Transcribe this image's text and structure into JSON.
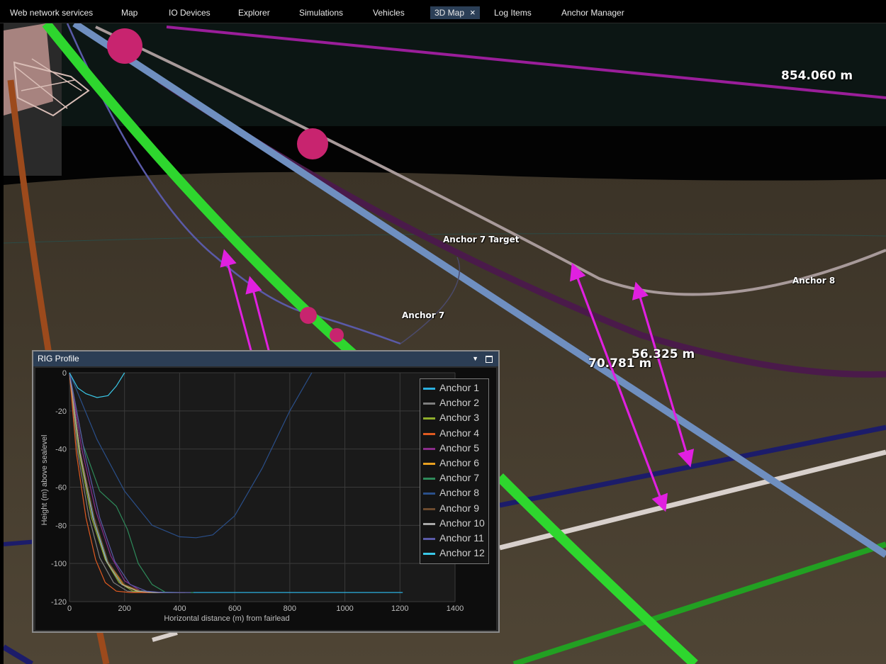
{
  "tabs": [
    {
      "label": "Web network services",
      "active": false
    },
    {
      "label": "Map",
      "active": false
    },
    {
      "label": "IO Devices",
      "active": false
    },
    {
      "label": "Explorer",
      "active": false
    },
    {
      "label": "Simulations",
      "active": false
    },
    {
      "label": "Vehicles",
      "active": false
    },
    {
      "label": "3D Map",
      "active": true,
      "closable": true,
      "close_icon": "×"
    },
    {
      "label": "Log Items",
      "active": false
    },
    {
      "label": "Anchor Manager",
      "active": false
    }
  ],
  "scene": {
    "labels": {
      "distance_top": "854.060 m",
      "anchor7_target": "Anchor 7 Target",
      "anchor8": "Anchor 8",
      "anchor7": "Anchor 7",
      "distance_a": "70.781 m",
      "distance_b": "56.325 m"
    },
    "colors": {
      "seabed": "#4a4032",
      "water": "#0c1614",
      "green_line": "#2ed62e",
      "blue_line": "#6f8fc0",
      "purple_line": "#4a1a4a",
      "magenta_arrow": "#e020e0",
      "buoy": "#c8246f"
    }
  },
  "rig_panel": {
    "title": "RIG Profile",
    "dropdown_icon": "▼",
    "maximize_icon": "maximize-icon"
  },
  "chart_data": {
    "type": "line",
    "title": "",
    "xlabel": "Horizontal distance (m) from fairlead",
    "ylabel": "Height (m) above sealevel",
    "xlim": [
      0,
      1400
    ],
    "ylim": [
      -120,
      0
    ],
    "x_ticks": [
      0,
      200,
      400,
      600,
      800,
      1000,
      1200,
      1400
    ],
    "y_ticks": [
      0,
      -20,
      -40,
      -60,
      -80,
      -100,
      -120
    ],
    "grid": true,
    "legend": "top-right",
    "series": [
      {
        "name": "Anchor 1",
        "color": "#2bb0e0",
        "points": [
          [
            0,
            0
          ],
          [
            40,
            -42
          ],
          [
            90,
            -78
          ],
          [
            140,
            -100
          ],
          [
            190,
            -111
          ],
          [
            240,
            -114
          ],
          [
            300,
            -115
          ],
          [
            400,
            -115.2
          ],
          [
            800,
            -115.2
          ],
          [
            1210,
            -115.2
          ]
        ]
      },
      {
        "name": "Anchor 2",
        "color": "#7f7f7f",
        "points": [
          [
            0,
            0
          ],
          [
            30,
            -42
          ],
          [
            70,
            -75
          ],
          [
            110,
            -97
          ],
          [
            160,
            -110
          ],
          [
            210,
            -114.5
          ],
          [
            270,
            -115.2
          ],
          [
            400,
            -115.2
          ]
        ]
      },
      {
        "name": "Anchor 3",
        "color": "#8fae2b",
        "points": [
          [
            0,
            0
          ],
          [
            35,
            -42
          ],
          [
            80,
            -76
          ],
          [
            130,
            -98
          ],
          [
            180,
            -110
          ],
          [
            230,
            -114.5
          ],
          [
            290,
            -115.2
          ],
          [
            420,
            -115.2
          ]
        ]
      },
      {
        "name": "Anchor 4",
        "color": "#e05a20",
        "points": [
          [
            0,
            0
          ],
          [
            25,
            -42
          ],
          [
            60,
            -76
          ],
          [
            95,
            -98
          ],
          [
            130,
            -110
          ],
          [
            170,
            -114.5
          ],
          [
            220,
            -115.2
          ],
          [
            300,
            -115.2
          ]
        ]
      },
      {
        "name": "Anchor 5",
        "color": "#8a2c8a",
        "points": [
          [
            0,
            0
          ],
          [
            45,
            -40
          ],
          [
            95,
            -72
          ],
          [
            150,
            -96
          ],
          [
            200,
            -109
          ],
          [
            260,
            -114.5
          ],
          [
            320,
            -115.2
          ],
          [
            420,
            -115.2
          ]
        ]
      },
      {
        "name": "Anchor 6",
        "color": "#e8a020",
        "points": [
          [
            0,
            0
          ],
          [
            40,
            -42
          ],
          [
            90,
            -76
          ],
          [
            140,
            -99
          ],
          [
            195,
            -111
          ],
          [
            250,
            -114.5
          ],
          [
            310,
            -115.2
          ],
          [
            420,
            -115.2
          ]
        ]
      },
      {
        "name": "Anchor 7",
        "color": "#2e8a5a",
        "points": [
          [
            0,
            0
          ],
          [
            50,
            -38
          ],
          [
            110,
            -62
          ],
          [
            170,
            -70
          ],
          [
            210,
            -82
          ],
          [
            250,
            -100
          ],
          [
            300,
            -111
          ],
          [
            350,
            -115.2
          ],
          [
            450,
            -115.2
          ]
        ]
      },
      {
        "name": "Anchor 8",
        "color": "#2a4f8a",
        "points": [
          [
            0,
            0
          ],
          [
            100,
            -35
          ],
          [
            200,
            -62
          ],
          [
            300,
            -80
          ],
          [
            400,
            -86
          ],
          [
            460,
            -86.5
          ],
          [
            520,
            -85
          ],
          [
            600,
            -75
          ],
          [
            700,
            -50
          ],
          [
            800,
            -20
          ],
          [
            880,
            0
          ]
        ]
      },
      {
        "name": "Anchor 9",
        "color": "#6b4a2e",
        "points": [
          [
            0,
            0
          ],
          [
            40,
            -42
          ],
          [
            90,
            -76
          ],
          [
            140,
            -99
          ],
          [
            200,
            -111
          ],
          [
            260,
            -114.5
          ],
          [
            330,
            -115.2
          ],
          [
            440,
            -115.2
          ]
        ]
      },
      {
        "name": "Anchor 10",
        "color": "#a8a8a8",
        "points": [
          [
            0,
            0
          ],
          [
            38,
            -42
          ],
          [
            85,
            -76
          ],
          [
            135,
            -99
          ],
          [
            190,
            -111
          ],
          [
            245,
            -114.5
          ],
          [
            305,
            -115.2
          ],
          [
            420,
            -115.2
          ]
        ]
      },
      {
        "name": "Anchor 11",
        "color": "#5a5aa8",
        "points": [
          [
            0,
            0
          ],
          [
            55,
            -42
          ],
          [
            110,
            -76
          ],
          [
            165,
            -99
          ],
          [
            220,
            -111
          ],
          [
            280,
            -114.5
          ],
          [
            340,
            -115.2
          ],
          [
            440,
            -115.2
          ]
        ]
      },
      {
        "name": "Anchor 12",
        "color": "#3ac8e8",
        "points": [
          [
            0,
            0
          ],
          [
            30,
            -8
          ],
          [
            60,
            -11
          ],
          [
            100,
            -13
          ],
          [
            140,
            -12
          ],
          [
            170,
            -7
          ],
          [
            200,
            0
          ]
        ]
      }
    ]
  }
}
